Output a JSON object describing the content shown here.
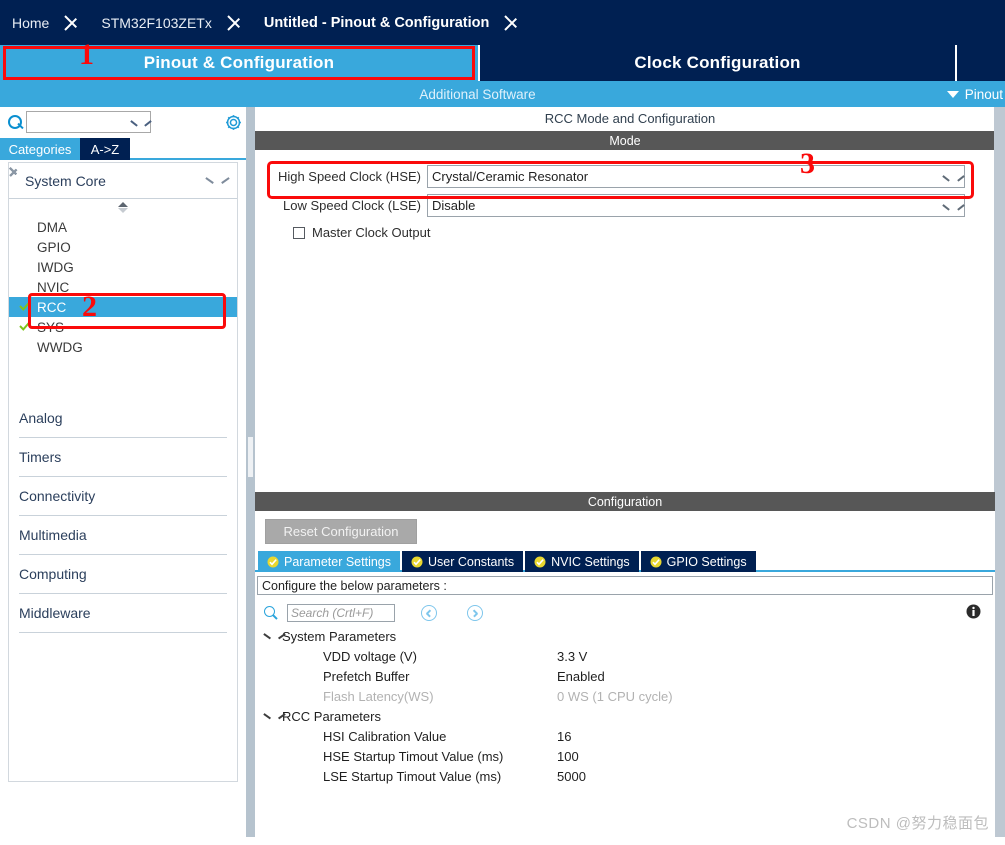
{
  "breadcrumb": {
    "items": [
      {
        "label": "Home",
        "active": false
      },
      {
        "label": "STM32F103ZETx",
        "active": false
      },
      {
        "label": "Untitled - Pinout & Configuration",
        "active": true
      }
    ]
  },
  "main_tabs": [
    {
      "label": "Pinout & Configuration",
      "selected": true
    },
    {
      "label": "Clock Configuration",
      "selected": false
    }
  ],
  "subbar": {
    "additional_software": "Additional Software",
    "pinout_dropdown": "Pinout",
    "caret_icon": "chevron-down-icon"
  },
  "sidebar": {
    "search": {
      "value": "",
      "placeholder": ""
    },
    "search_icon": "search-icon",
    "settings_icon": "gear-icon",
    "tabs": [
      {
        "label": "Categories",
        "selected": true
      },
      {
        "label": "A->Z",
        "selected": false
      }
    ],
    "system_core": {
      "title": "System Core",
      "expanded": true,
      "caret_icon": "chevron-down-icon",
      "peripherals": [
        {
          "label": "DMA",
          "checked": false,
          "selected": false
        },
        {
          "label": "GPIO",
          "checked": false,
          "selected": false
        },
        {
          "label": "IWDG",
          "checked": false,
          "selected": false
        },
        {
          "label": "NVIC",
          "checked": false,
          "selected": false
        },
        {
          "label": "RCC",
          "checked": true,
          "selected": true
        },
        {
          "label": "SYS",
          "checked": true,
          "selected": false
        },
        {
          "label": "WWDG",
          "checked": false,
          "selected": false
        }
      ]
    },
    "categories": [
      {
        "label": "Analog",
        "caret_icon": "chevron-right-icon"
      },
      {
        "label": "Timers",
        "caret_icon": "chevron-right-icon"
      },
      {
        "label": "Connectivity",
        "caret_icon": "chevron-right-icon"
      },
      {
        "label": "Multimedia",
        "caret_icon": "chevron-right-icon"
      },
      {
        "label": "Computing",
        "caret_icon": "chevron-right-icon"
      },
      {
        "label": "Middleware",
        "caret_icon": "chevron-right-icon"
      }
    ]
  },
  "rcc_panel": {
    "title": "RCC Mode and Configuration",
    "mode_section": {
      "header": "Mode",
      "rows": [
        {
          "label": "High Speed Clock (HSE)",
          "value": "Crystal/Ceramic Resonator",
          "caret_icon": "chevron-down-icon"
        },
        {
          "label": "Low Speed Clock (LSE)",
          "value": "Disable",
          "caret_icon": "chevron-down-icon"
        }
      ],
      "checkbox": {
        "label": "Master Clock Output",
        "checked": false
      }
    },
    "config_section": {
      "header": "Configuration",
      "reset_button": "Reset Configuration",
      "tabs": [
        {
          "label": "Parameter Settings",
          "selected": true,
          "icon": "check-circle-icon"
        },
        {
          "label": "User Constants",
          "selected": false,
          "icon": "check-circle-icon"
        },
        {
          "label": "NVIC Settings",
          "selected": false,
          "icon": "check-circle-icon"
        },
        {
          "label": "GPIO Settings",
          "selected": false,
          "icon": "check-circle-icon"
        }
      ],
      "hint": "Configure the below parameters :",
      "toolbar": {
        "search_placeholder": "Search (Crtl+F)",
        "search_value": "",
        "search_icon": "search-icon",
        "prev_icon": "circle-left-arrow-icon",
        "next_icon": "circle-right-arrow-icon",
        "info_icon": "info-icon"
      },
      "groups": [
        {
          "name": "System Parameters",
          "caret_icon": "chevron-down-icon",
          "params": [
            {
              "name": "VDD voltage (V)",
              "value": "3.3 V",
              "disabled": false
            },
            {
              "name": "Prefetch Buffer",
              "value": "Enabled",
              "disabled": false
            },
            {
              "name": "Flash Latency(WS)",
              "value": "0 WS (1 CPU cycle)",
              "disabled": true
            }
          ]
        },
        {
          "name": "RCC Parameters",
          "caret_icon": "chevron-down-icon",
          "params": [
            {
              "name": "HSI Calibration Value",
              "value": "16",
              "disabled": false
            },
            {
              "name": "HSE Startup Timout Value (ms)",
              "value": "100",
              "disabled": false
            },
            {
              "name": "LSE Startup Timout Value (ms)",
              "value": "5000",
              "disabled": false
            }
          ]
        }
      ]
    }
  },
  "annotations": [
    {
      "number": "1",
      "target": "pinout-configuration-tab"
    },
    {
      "number": "2",
      "target": "sidebar-item-rcc"
    },
    {
      "number": "3",
      "target": "high-speed-clock-row"
    }
  ],
  "watermark": "CSDN @努力稳面包",
  "colors": {
    "navy": "#002052",
    "accent_blue": "#39a8dc",
    "section_gray": "#575757",
    "annotation_red": "#fa0a0a",
    "check_green": "#7fc41a",
    "tab_icon_gold": "#e8d72f"
  }
}
